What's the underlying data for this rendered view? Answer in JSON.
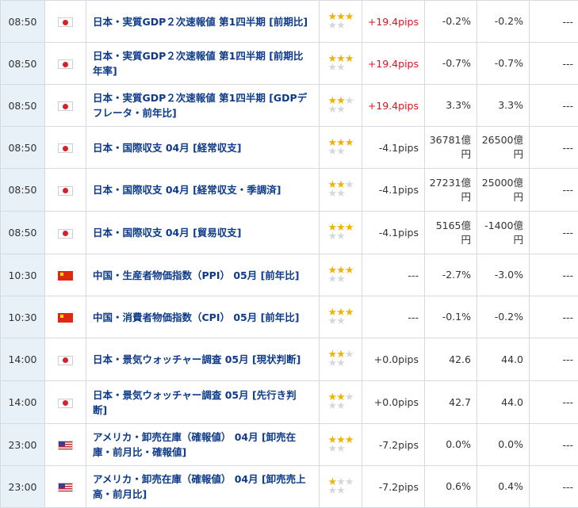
{
  "colors": {
    "time_bg": "#e8f0f8",
    "link": "#0d3b8a",
    "positive": "#e0141e",
    "star_on": "#f0b400",
    "star_off": "#d4d8dd",
    "grid": "#d6dbe1"
  },
  "rows": [
    {
      "time": "08:50",
      "country": "jp",
      "flag_icon": "japan-flag-icon",
      "name_lines": [
        "日本・実質GDP２次速報値 第1四半期 [前期比]"
      ],
      "stars": 3,
      "pips": "+19.4pips",
      "pips_pos": true,
      "actual": [
        "-0.2%"
      ],
      "forecast": [
        "-0.2%"
      ],
      "result": "---"
    },
    {
      "time": "08:50",
      "country": "jp",
      "flag_icon": "japan-flag-icon",
      "name_lines": [
        "日本・実質GDP２次速報値 第1四半期 [前期比",
        "年率]"
      ],
      "stars": 3,
      "pips": "+19.4pips",
      "pips_pos": true,
      "actual": [
        "-0.7%"
      ],
      "forecast": [
        "-0.7%"
      ],
      "result": "---"
    },
    {
      "time": "08:50",
      "country": "jp",
      "flag_icon": "japan-flag-icon",
      "name_lines": [
        "日本・実質GDP２次速報値 第1四半期 [GDPデ",
        "フレータ・前年比]"
      ],
      "stars": 2,
      "pips": "+19.4pips",
      "pips_pos": true,
      "actual": [
        "3.3%"
      ],
      "forecast": [
        "3.3%"
      ],
      "result": "---"
    },
    {
      "time": "08:50",
      "country": "jp",
      "flag_icon": "japan-flag-icon",
      "name_lines": [
        "日本・国際収支 04月 [経常収支]"
      ],
      "stars": 3,
      "pips": "-4.1pips",
      "pips_pos": false,
      "actual": [
        "36781億",
        "円"
      ],
      "forecast": [
        "26500億",
        "円"
      ],
      "result": "---"
    },
    {
      "time": "08:50",
      "country": "jp",
      "flag_icon": "japan-flag-icon",
      "name_lines": [
        "日本・国際収支 04月 [経常収支・季調済]"
      ],
      "stars": 2,
      "pips": "-4.1pips",
      "pips_pos": false,
      "actual": [
        "27231億",
        "円"
      ],
      "forecast": [
        "25000億",
        "円"
      ],
      "result": "---"
    },
    {
      "time": "08:50",
      "country": "jp",
      "flag_icon": "japan-flag-icon",
      "name_lines": [
        "日本・国際収支 04月 [貿易収支]"
      ],
      "stars": 3,
      "pips": "-4.1pips",
      "pips_pos": false,
      "actual": [
        "5165億",
        "円"
      ],
      "forecast": [
        "-1400億",
        "円"
      ],
      "result": "---"
    },
    {
      "time": "10:30",
      "country": "cn",
      "flag_icon": "china-flag-icon",
      "name_lines": [
        "中国・生産者物価指数（PPI） 05月 [前年比]"
      ],
      "stars": 3,
      "pips": "---",
      "pips_pos": false,
      "actual": [
        "-2.7%"
      ],
      "forecast": [
        "-3.0%"
      ],
      "result": "---"
    },
    {
      "time": "10:30",
      "country": "cn",
      "flag_icon": "china-flag-icon",
      "name_lines": [
        "中国・消費者物価指数（CPI） 05月 [前年比]"
      ],
      "stars": 3,
      "pips": "---",
      "pips_pos": false,
      "actual": [
        "-0.1%"
      ],
      "forecast": [
        "-0.2%"
      ],
      "result": "---"
    },
    {
      "time": "14:00",
      "country": "jp",
      "flag_icon": "japan-flag-icon",
      "name_lines": [
        "日本・景気ウォッチャー調査 05月 [現状判断]"
      ],
      "stars": 2,
      "pips": "+0.0pips",
      "pips_pos": false,
      "actual": [
        "42.6"
      ],
      "forecast": [
        "44.0"
      ],
      "result": "---"
    },
    {
      "time": "14:00",
      "country": "jp",
      "flag_icon": "japan-flag-icon",
      "name_lines": [
        "日本・景気ウォッチャー調査 05月 [先行き判",
        "断]"
      ],
      "stars": 2,
      "pips": "+0.0pips",
      "pips_pos": false,
      "actual": [
        "42.7"
      ],
      "forecast": [
        "44.0"
      ],
      "result": "---"
    },
    {
      "time": "23:00",
      "country": "us",
      "flag_icon": "usa-flag-icon",
      "name_lines": [
        "アメリカ・卸売在庫（確報値） 04月 [卸売在",
        "庫・前月比・確報値]"
      ],
      "stars": 3,
      "pips": "-7.2pips",
      "pips_pos": false,
      "actual": [
        "0.0%"
      ],
      "forecast": [
        "0.0%"
      ],
      "result": "---"
    },
    {
      "time": "23:00",
      "country": "us",
      "flag_icon": "usa-flag-icon",
      "name_lines": [
        "アメリカ・卸売在庫（確報値） 04月 [卸売売上",
        "高・前月比]"
      ],
      "stars": 1,
      "pips": "-7.2pips",
      "pips_pos": false,
      "actual": [
        "0.6%"
      ],
      "forecast": [
        "0.4%"
      ],
      "result": "---"
    }
  ]
}
